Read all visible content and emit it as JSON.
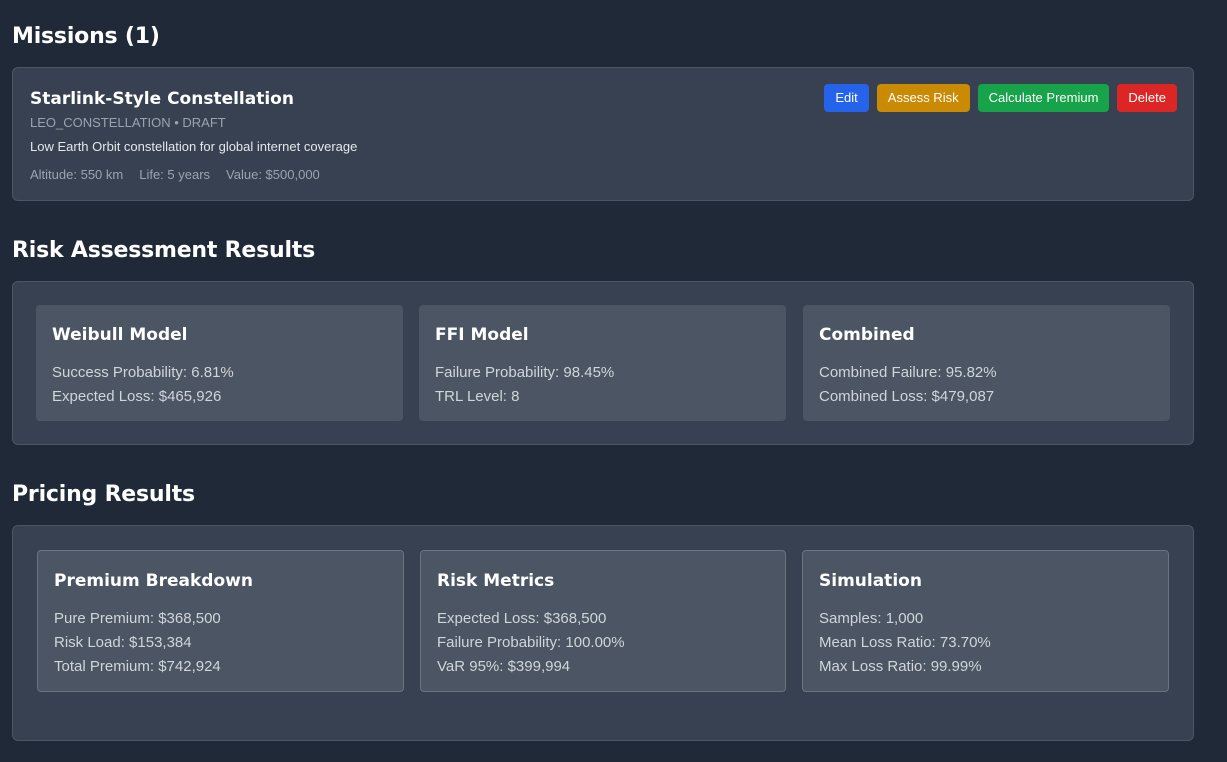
{
  "missions": {
    "title": "Missions (1)",
    "items": [
      {
        "name": "Starlink-Style Constellation",
        "type_status": "LEO_CONSTELLATION • DRAFT",
        "description": "Low Earth Orbit constellation for global internet coverage",
        "altitude": "Altitude: 550 km",
        "life": "Life: 5 years",
        "value": "Value: $500,000",
        "actions": {
          "edit": "Edit",
          "assess": "Assess Risk",
          "calculate": "Calculate Premium",
          "delete": "Delete"
        },
        "action_colors": {
          "edit": "#2563eb",
          "assess": "#ca8a04",
          "calculate": "#16a34a",
          "delete": "#dc2626"
        }
      }
    ]
  },
  "risk": {
    "title": "Risk Assessment Results",
    "cards": [
      {
        "title": "Weibull Model",
        "lines": [
          "Success Probability: 6.81%",
          "Expected Loss: $465,926"
        ]
      },
      {
        "title": "FFI Model",
        "lines": [
          "Failure Probability: 98.45%",
          "TRL Level: 8"
        ]
      },
      {
        "title": "Combined",
        "lines": [
          "Combined Failure: 95.82%",
          "Combined Loss: $479,087"
        ]
      }
    ]
  },
  "pricing": {
    "title": "Pricing Results",
    "cards": [
      {
        "title": "Premium Breakdown",
        "lines": [
          "Pure Premium: $368,500",
          "Risk Load: $153,384",
          "Total Premium: $742,924"
        ]
      },
      {
        "title": "Risk Metrics",
        "lines": [
          "Expected Loss: $368,500",
          "Failure Probability: 100.00%",
          "VaR 95%: $399,994"
        ]
      },
      {
        "title": "Simulation",
        "lines": [
          "Samples: 1,000",
          "Mean Loss Ratio: 73.70%",
          "Max Loss Ratio: 99.99%"
        ]
      }
    ]
  }
}
